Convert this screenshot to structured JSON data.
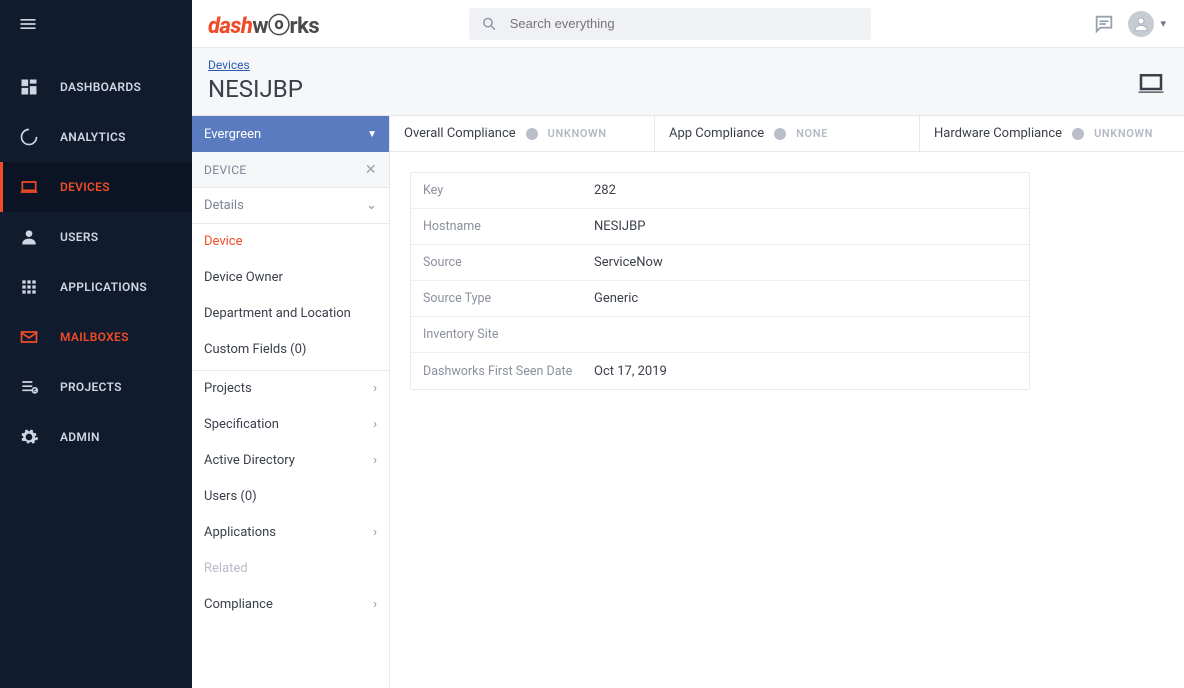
{
  "nav": {
    "items": [
      {
        "label": "DASHBOARDS"
      },
      {
        "label": "ANALYTICS"
      },
      {
        "label": "DEVICES"
      },
      {
        "label": "USERS"
      },
      {
        "label": "APPLICATIONS"
      },
      {
        "label": "MAILBOXES"
      },
      {
        "label": "PROJECTS"
      },
      {
        "label": "ADMIN"
      }
    ]
  },
  "search": {
    "placeholder": "Search everything"
  },
  "breadcrumb": {
    "parent": "Devices",
    "title": "NESIJBP"
  },
  "subpanel": {
    "project_selector": "Evergreen",
    "section_header": "DEVICE",
    "detailsLabel": "Details",
    "detailsItems": [
      {
        "label": "Device"
      },
      {
        "label": "Device Owner"
      },
      {
        "label": "Department and Location"
      },
      {
        "label": "Custom Fields (0)"
      }
    ],
    "rows": [
      {
        "label": "Projects"
      },
      {
        "label": "Specification"
      },
      {
        "label": "Active Directory"
      },
      {
        "label": "Users (0)"
      },
      {
        "label": "Applications"
      }
    ],
    "relatedLabel": "Related",
    "complianceLabel": "Compliance"
  },
  "compliance": [
    {
      "title": "Overall Compliance",
      "status": "UNKNOWN"
    },
    {
      "title": "App Compliance",
      "status": "NONE"
    },
    {
      "title": "Hardware Compliance",
      "status": "UNKNOWN"
    }
  ],
  "details": [
    {
      "label": "Key",
      "value": "282"
    },
    {
      "label": "Hostname",
      "value": "NESIJBP"
    },
    {
      "label": "Source",
      "value": "ServiceNow"
    },
    {
      "label": "Source Type",
      "value": "Generic"
    },
    {
      "label": "Inventory Site",
      "value": ""
    },
    {
      "label": "Dashworks First Seen Date",
      "value": "Oct 17, 2019"
    }
  ]
}
